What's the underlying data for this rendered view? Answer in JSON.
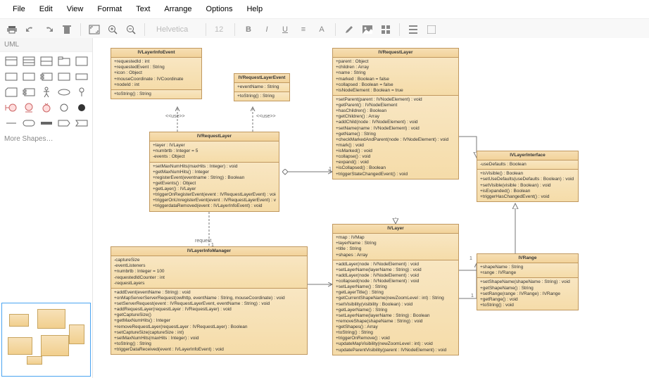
{
  "menu": {
    "file": "File",
    "edit": "Edit",
    "view": "View",
    "format": "Format",
    "text": "Text",
    "arrange": "Arrange",
    "options": "Options",
    "help": "Help"
  },
  "toolbar": {
    "font_placeholder": "Helvetica",
    "size_placeholder": "12"
  },
  "sidebar": {
    "title": "UML",
    "more": "More Shapes…"
  },
  "connector_labels": {
    "use1": "<<use>>",
    "use2": "<<use>>",
    "request": "request",
    "one1": "1",
    "one2": "1",
    "one3": "1",
    "one4": "1"
  },
  "classes": {
    "layerInfoEvent": {
      "name": "IVLayerInfoEvent",
      "attrs": [
        "+requestedId : int",
        "+requestedEvent : String",
        "+icon : Object",
        "+mouseCoordinate : IVCoordinate",
        "+nodeId : int"
      ],
      "ops": [
        "+toString() : String"
      ]
    },
    "requestLayerEvent": {
      "name": "IVRequestLayerEvent",
      "attrs": [
        "+eventName : String"
      ],
      "ops": [
        "+toString() : String"
      ]
    },
    "requestLayer": {
      "name": "IVRequestLayer",
      "attrs": [
        "+layer : IVLayer",
        "+numbrtb : Integer = 5",
        "-events : Object"
      ],
      "ops": [
        "+setMaxNumHits(maxHits : Integer) : void",
        "+getMaxNumHits() : Integer",
        "+registerEvent(eventname : String) : Boolean",
        "+getEvents() : Object",
        "+getLayer() : IVLayer",
        "+triggerOnRegisterEvent(event : IVRequestLayerEvent) : void",
        "+triggerOnUnregisterEvent(event : IVRequestLayerEvent) : void",
        "+triggerdataRemoved(event : IVLayerInfoEvent) : void"
      ]
    },
    "requestLayer2": {
      "name": "IVRequestLayer",
      "attrs": [
        "+parent : Object",
        "+children : Array",
        "+name : String",
        "+marked : Boolean = false",
        "+collapsed : Boolean = false",
        "+isNodeElement : Boolean = true"
      ],
      "ops": [
        "+setParent(parent : IVNodeElement) : void",
        "+getParent() : IVNodeElement",
        "+hasChildren() : Boolean",
        "+getChildren() : Array",
        "+addChild(node : IVNodeElement) : void",
        "+setName(name : IVNodeElement) : void",
        "+getName() : String",
        "+checkMarkedAndParent(node : IVNodeElement) : void",
        "+mark() : void",
        "+isMarked() : void",
        "+collapse() : void",
        "+expand() : void",
        "+isCollapsed() : Boolean",
        "+triggerStateChangedEvent() : void"
      ]
    },
    "layerInterface": {
      "name": "IVLayerInterface",
      "attrs": [
        "-useDefaults : Boolean"
      ],
      "ops": [
        "+isVisible() : Boolean",
        "+setUseDefaults(useDefaults : Boolean) : void",
        "+setVisible(visible : Boolean) : void",
        "+isExpanded() : Boolean",
        "+triggerHasChangedEvent() : void"
      ]
    },
    "layer": {
      "name": "IVLayer",
      "attrs": [
        "+map : IVMap",
        "+layerName : String",
        "+title : String",
        "+shapes : Array"
      ],
      "ops": [
        "+addLayer(node : IVNodeElement) : void",
        "+setLayerName(layerName : String) : void",
        "+addLayer(node : IVNodeElement) : void",
        "+collapsed(node : IVNodeElement) : void",
        "+setLayerName() : String",
        "+getLayerTitle() : String",
        "+getCurrentShapeName(newZoomLevel : int) : String",
        "+setVisibility(visibility : Boolean) : void",
        "+getLayerName() : String",
        "+setLayerName(layerName : String) : Boolean",
        "+removeShape(shapeName : String) : void",
        "+getShapes() : Array",
        "+toString() : String",
        "+triggerOnRemove() : void",
        "+updateMapVisibility(newZoomLevel : int) : void",
        "+updateParentVisibility(parent : IVNodeElement) : void"
      ]
    },
    "range": {
      "name": "IVRange",
      "attrs": [
        "+shapeName : String",
        "+range : IVRange"
      ],
      "ops": [
        "+setShapeName(shapeName : String) : void",
        "+getShapeName() : String",
        "+setRange(range : IVRange) : IVRange",
        "+getRange() : void",
        "+toString() : void"
      ]
    },
    "layerInfoManager": {
      "name": "IVLayerInfoManager",
      "attrs": [
        "-captureSize",
        "-eventListeners",
        "+numbrtb : Integer = 100",
        "-requestedIdCounter : int",
        "-requestLayers"
      ],
      "ops": [
        "+addEvent(eventName : String) : void",
        "+onMapServerServerRequest(owlhttp, eventName : String, mouseCoordinate) : void",
        "+setServerRequest(event : IVRequestLayerEvent, eventName : String) : void",
        "+addRequestLayer(requestLayer : IVRequestLayer) : void",
        "+getCaptureSize()",
        "+getMaxNumHits() : Integer",
        "+removeRequestLayer(requestLayer : IVRequestLayer) : Boolean",
        "+setCaptureSize(captureSize : int)",
        "+setMaxNumHits(maxHits : Integer) : void",
        "+toString() : String",
        "+triggerDataReceived(event : IVLayerInfoEvent) : void"
      ]
    }
  }
}
